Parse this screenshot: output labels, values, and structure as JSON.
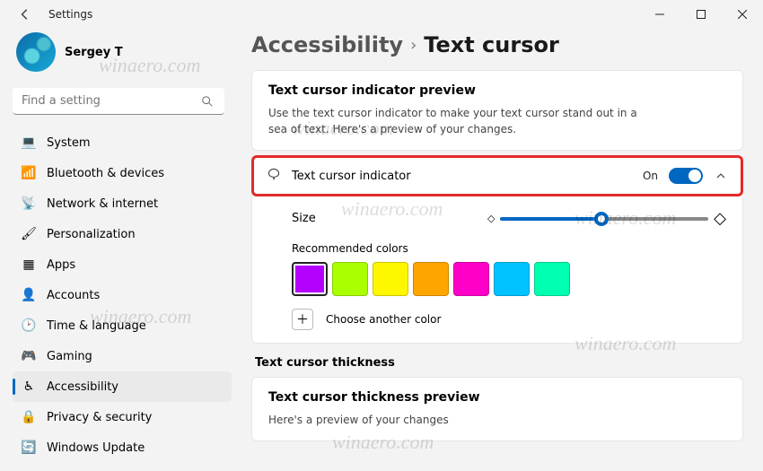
{
  "window_title": "Settings",
  "user": {
    "name": "Sergey T"
  },
  "search": {
    "placeholder": "Find a setting"
  },
  "sidebar": {
    "items": [
      {
        "label": "System",
        "icon": "💻"
      },
      {
        "label": "Bluetooth & devices",
        "icon": "📶"
      },
      {
        "label": "Network & internet",
        "icon": "📡"
      },
      {
        "label": "Personalization",
        "icon": "🖌"
      },
      {
        "label": "Apps",
        "icon": "▦"
      },
      {
        "label": "Accounts",
        "icon": "👤"
      },
      {
        "label": "Time & language",
        "icon": "🕑"
      },
      {
        "label": "Gaming",
        "icon": "🎮"
      },
      {
        "label": "Accessibility",
        "icon": "♿"
      },
      {
        "label": "Privacy & security",
        "icon": "🔒"
      },
      {
        "label": "Windows Update",
        "icon": "🔄"
      }
    ],
    "active_index": 8
  },
  "breadcrumb": {
    "parent": "Accessibility",
    "current": "Text cursor"
  },
  "preview": {
    "title": "Text cursor indicator preview",
    "text": "Use the text cursor indicator to make your text cursor stand out in a sea of text. Here's a preview of your changes."
  },
  "indicator": {
    "label": "Text cursor indicator",
    "state": "On",
    "on": true,
    "size_label": "Size",
    "colors_label": "Recommended colors",
    "swatches": [
      "#b400ff",
      "#aaff00",
      "#fff700",
      "#ffa500",
      "#ff00c8",
      "#00c3ff",
      "#00ffb0"
    ],
    "selected_swatch": 0,
    "choose_label": "Choose another color"
  },
  "thickness": {
    "section_title": "Text cursor thickness",
    "preview_title": "Text cursor thickness preview",
    "preview_text": "Here's a preview of your changes"
  },
  "watermark": "winaero.com"
}
